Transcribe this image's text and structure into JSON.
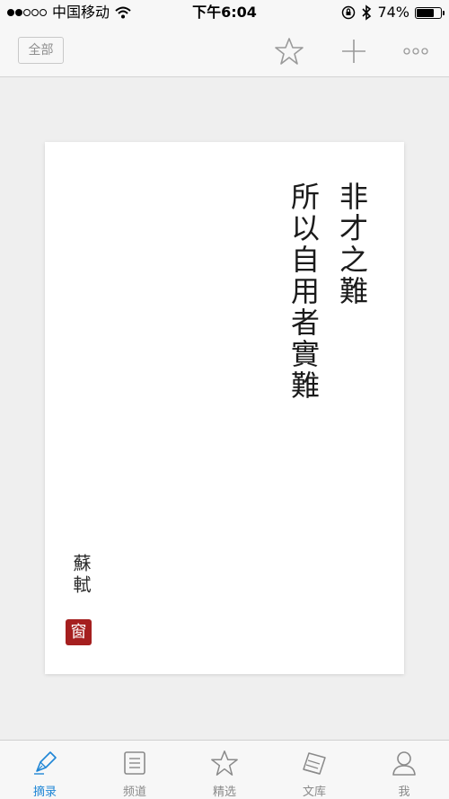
{
  "status_bar": {
    "carrier": "中国移动",
    "time": "下午6:04",
    "battery_percent": "74%",
    "battery_level": 0.74,
    "signal_bars": 2,
    "icons": [
      "wifi-icon",
      "rotation-lock-icon",
      "bluetooth-icon",
      "battery-icon"
    ]
  },
  "nav": {
    "filter_label": "全部",
    "icons": [
      "star-icon",
      "plus-icon",
      "more-icon"
    ]
  },
  "card": {
    "quote_line_1": "非才之難",
    "quote_line_2": "所以自用者實難",
    "author": "蘇軾",
    "seal_text": "窗"
  },
  "tabs": [
    {
      "label": "摘录",
      "icon": "pen-icon",
      "active": true
    },
    {
      "label": "频道",
      "icon": "list-icon",
      "active": false
    },
    {
      "label": "精选",
      "icon": "star-icon",
      "active": false
    },
    {
      "label": "文库",
      "icon": "books-icon",
      "active": false
    },
    {
      "label": "我",
      "icon": "person-icon",
      "active": false
    }
  ],
  "colors": {
    "accent": "#1f86d6",
    "seal_red": "#a51f1f",
    "background": "#efefef"
  }
}
